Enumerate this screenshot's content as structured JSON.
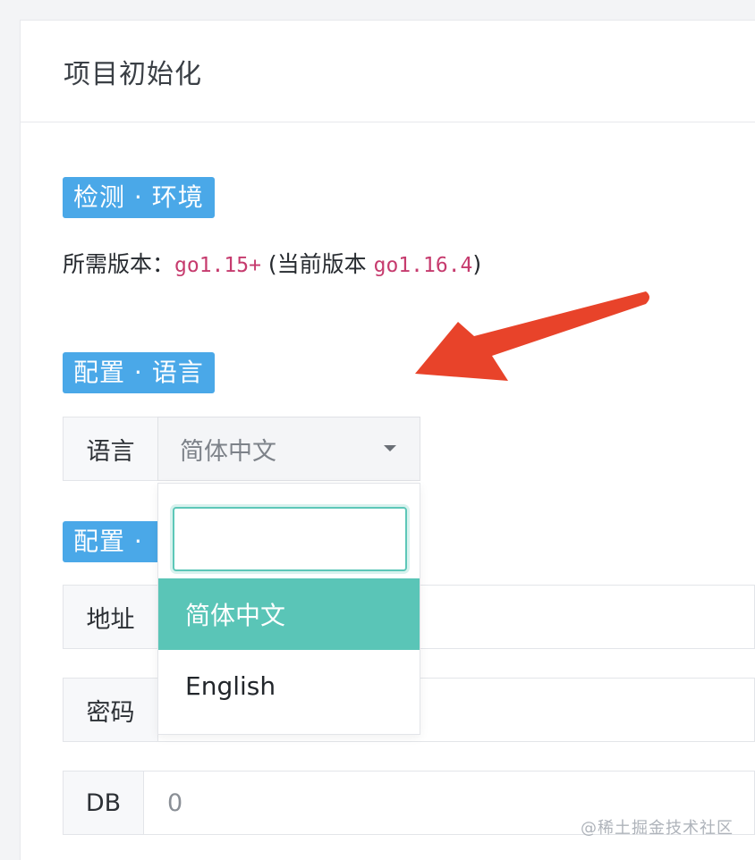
{
  "header": {
    "title": "项目初始化"
  },
  "sections": {
    "env": {
      "label": "检测 · 环境",
      "version_prefix": "所需版本：",
      "required_version": "go1.15+",
      "current_open": " (当前版本 ",
      "current_version": "go1.16.4",
      "current_close": ")"
    },
    "language": {
      "label": "配置 · 语言",
      "field_label": "语言",
      "selected_value": "简体中文",
      "search_value": "",
      "options": [
        "简体中文",
        "English"
      ]
    },
    "redis": {
      "label": "配置 · ",
      "address_label": "地址",
      "password_label": "密码",
      "db_label": "DB",
      "db_value": "0"
    }
  },
  "watermark": "@稀土掘金技术社区",
  "colors": {
    "section_label_bg": "#4aa8e8",
    "option_selected_bg": "#5ac5b7",
    "annotation_arrow": "#e8432a",
    "code_text": "#c63b6e"
  }
}
